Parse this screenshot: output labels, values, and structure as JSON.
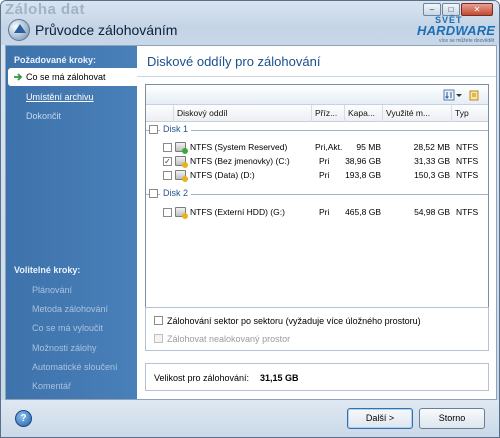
{
  "window": {
    "bg_title": "Záloha dat",
    "title": "Průvodce zálohováním",
    "controls": {
      "minimize": "–",
      "maximize": "□",
      "close": "✕"
    }
  },
  "watermark": {
    "top": "SVĚT",
    "main": "HARDWARE",
    "sub": "více se můžete dozvědět"
  },
  "sidebar": {
    "required_heading": "Požadované kroky:",
    "required_items": [
      {
        "label": "Co se má zálohovat",
        "state": "active"
      },
      {
        "label": "Umístění archivu",
        "state": "link"
      },
      {
        "label": "Dokončit",
        "state": "dim"
      }
    ],
    "optional_heading": "Volitelné kroky:",
    "optional_items": [
      {
        "label": "Plánování"
      },
      {
        "label": "Metoda zálohování"
      },
      {
        "label": "Co se má vyloučit"
      },
      {
        "label": "Možnosti zálohy"
      },
      {
        "label": "Automatické sloučení"
      },
      {
        "label": "Komentář"
      }
    ]
  },
  "main": {
    "title": "Diskové oddíly pro zálohování",
    "toolbar": {
      "sort_icon": "sort-icon",
      "dropdown_icon": "chevron-down-icon",
      "refresh_icon": "refresh-icon"
    },
    "columns": [
      "Diskový oddíl",
      "Příz...",
      "Kapa...",
      "Využité m...",
      "Typ"
    ],
    "groups": [
      {
        "name": "Disk 1",
        "rows": [
          {
            "checked": false,
            "badge": "green",
            "name": "NTFS (System Reserved)",
            "flag": "Pri,Akt.",
            "capacity": "95 MB",
            "used": "28,52 MB",
            "type": "NTFS"
          },
          {
            "checked": true,
            "badge": "yellow",
            "name": "NTFS (Bez jmenovky) (C:)",
            "flag": "Pri",
            "capacity": "38,96 GB",
            "used": "31,33 GB",
            "type": "NTFS"
          },
          {
            "checked": false,
            "badge": "yellow",
            "name": "NTFS (Data) (D:)",
            "flag": "Pri",
            "capacity": "193,8 GB",
            "used": "150,3 GB",
            "type": "NTFS"
          }
        ]
      },
      {
        "name": "Disk 2",
        "rows": [
          {
            "checked": false,
            "badge": "yellow",
            "name": "NTFS (Externí HDD) (G:)",
            "flag": "Pri",
            "capacity": "465,8 GB",
            "used": "54,98 GB",
            "type": "NTFS"
          }
        ]
      }
    ],
    "options": {
      "sector_by_sector": "Zálohování sektor po sektoru (vyžaduje více úložného prostoru)",
      "unallocated": "Zálohovat nealokovaný prostor"
    },
    "size": {
      "label": "Velikost pro zálohování:",
      "value": "31,15 GB"
    }
  },
  "footer": {
    "help": "?",
    "next": "Další >",
    "cancel": "Storno"
  }
}
